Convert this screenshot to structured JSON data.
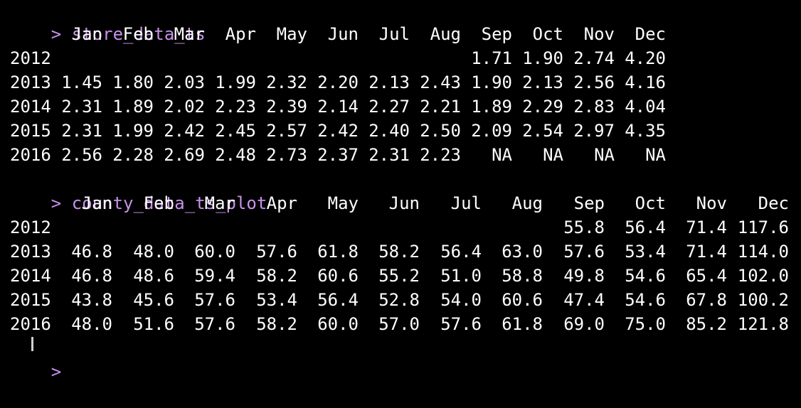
{
  "terminal": {
    "prompt_symbol": ">",
    "commands": [
      "store_data_ts",
      "county_data_ts_plot"
    ]
  },
  "store_table": {
    "months": [
      "Jan",
      "Feb",
      "Mar",
      "Apr",
      "May",
      "Jun",
      "Jul",
      "Aug",
      "Sep",
      "Oct",
      "Nov",
      "Dec"
    ],
    "rows": [
      {
        "year": "2012",
        "values": [
          "",
          "",
          "",
          "",
          "",
          "",
          "",
          "",
          "1.71",
          "1.90",
          "2.74",
          "4.20"
        ]
      },
      {
        "year": "2013",
        "values": [
          "1.45",
          "1.80",
          "2.03",
          "1.99",
          "2.32",
          "2.20",
          "2.13",
          "2.43",
          "1.90",
          "2.13",
          "2.56",
          "4.16"
        ]
      },
      {
        "year": "2014",
        "values": [
          "2.31",
          "1.89",
          "2.02",
          "2.23",
          "2.39",
          "2.14",
          "2.27",
          "2.21",
          "1.89",
          "2.29",
          "2.83",
          "4.04"
        ]
      },
      {
        "year": "2015",
        "values": [
          "2.31",
          "1.99",
          "2.42",
          "2.45",
          "2.57",
          "2.42",
          "2.40",
          "2.50",
          "2.09",
          "2.54",
          "2.97",
          "4.35"
        ]
      },
      {
        "year": "2016",
        "values": [
          "2.56",
          "2.28",
          "2.69",
          "2.48",
          "2.73",
          "2.37",
          "2.31",
          "2.23",
          "NA",
          "NA",
          "NA",
          "NA"
        ]
      }
    ]
  },
  "county_table": {
    "months": [
      "Jan",
      "Feb",
      "Mar",
      "Apr",
      "May",
      "Jun",
      "Jul",
      "Aug",
      "Sep",
      "Oct",
      "Nov",
      "Dec"
    ],
    "rows": [
      {
        "year": "2012",
        "values": [
          "",
          "",
          "",
          "",
          "",
          "",
          "",
          "",
          "55.8",
          "56.4",
          "71.4",
          "117.6"
        ]
      },
      {
        "year": "2013",
        "values": [
          "46.8",
          "48.0",
          "60.0",
          "57.6",
          "61.8",
          "58.2",
          "56.4",
          "63.0",
          "57.6",
          "53.4",
          "71.4",
          "114.0"
        ]
      },
      {
        "year": "2014",
        "values": [
          "46.8",
          "48.6",
          "59.4",
          "58.2",
          "60.6",
          "55.2",
          "51.0",
          "58.8",
          "49.8",
          "54.6",
          "65.4",
          "102.0"
        ]
      },
      {
        "year": "2015",
        "values": [
          "43.8",
          "45.6",
          "57.6",
          "53.4",
          "56.4",
          "52.8",
          "54.0",
          "60.6",
          "47.4",
          "54.6",
          "67.8",
          "100.2"
        ]
      },
      {
        "year": "2016",
        "values": [
          "48.0",
          "51.6",
          "57.6",
          "58.2",
          "60.0",
          "57.0",
          "57.6",
          "61.8",
          "69.0",
          "75.0",
          "85.2",
          "121.8"
        ]
      }
    ]
  },
  "colors": {
    "background": "#000000",
    "text": "#ffffff",
    "prompt": "#c792ea"
  }
}
